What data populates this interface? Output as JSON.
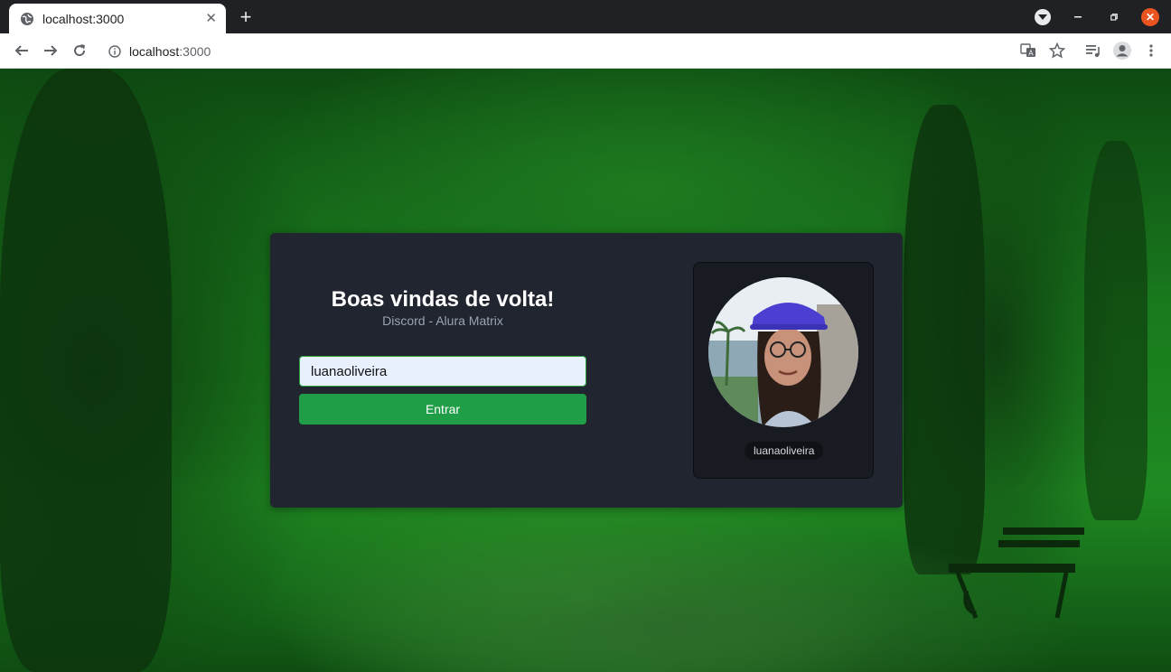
{
  "browser": {
    "tab_title": "localhost:3000",
    "url_host": "localhost",
    "url_port": ":3000"
  },
  "login": {
    "title": "Boas vindas de volta!",
    "subtitle": "Discord - Alura Matrix",
    "username_value": "luanaoliveira",
    "submit_label": "Entrar"
  },
  "profile": {
    "username": "luanaoliveira"
  },
  "colors": {
    "card_bg": "#212530",
    "button": "#1f9e47",
    "input_bg": "#e8f0fe",
    "profile_bg": "#181b22"
  }
}
